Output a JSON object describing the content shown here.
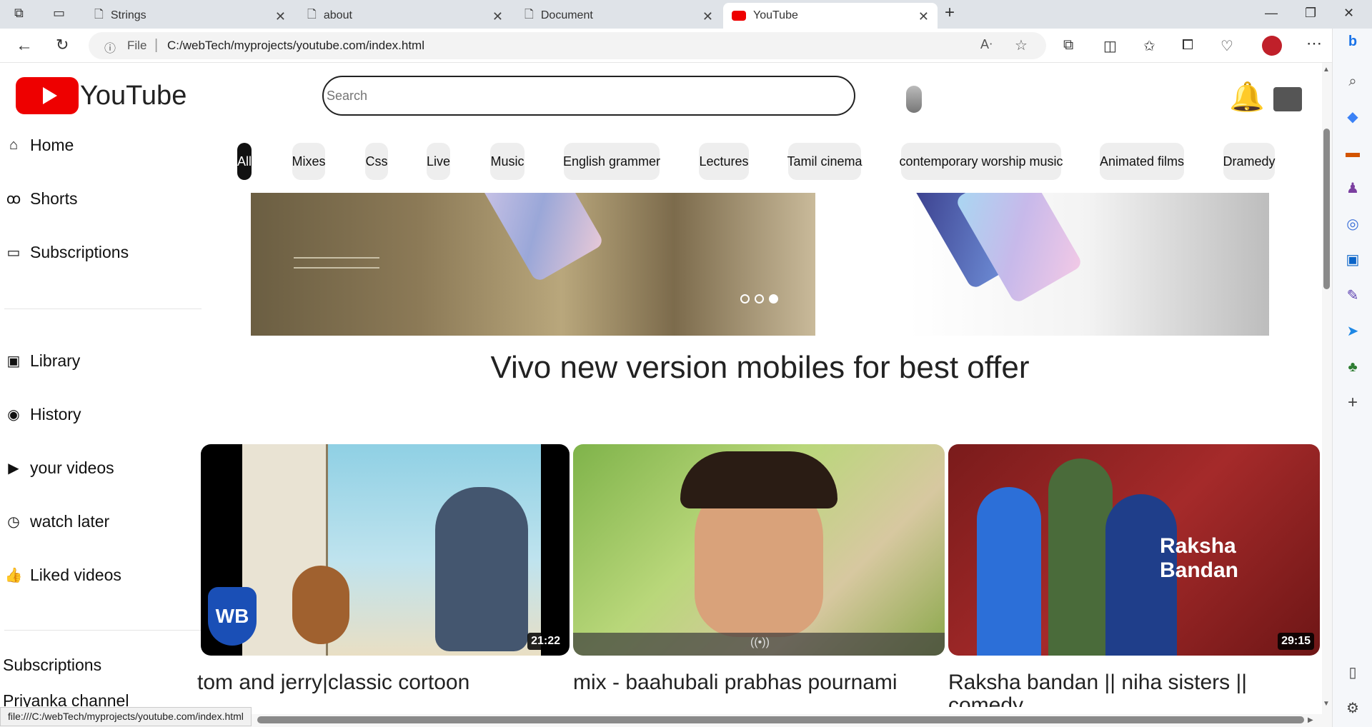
{
  "browser": {
    "tabs": [
      {
        "title": "Strings"
      },
      {
        "title": "about"
      },
      {
        "title": "Document"
      },
      {
        "title": "YouTube"
      }
    ],
    "address": {
      "scheme": "File",
      "url": "C:/webTech/myprojects/youtube.com/index.html"
    },
    "status_url": "file:///C:/webTech/myprojects/youtube.com/index.html"
  },
  "header": {
    "logo_text": "YouTube",
    "search_placeholder": "Search"
  },
  "sidebar": {
    "items": [
      {
        "label": "Home",
        "icon": "home-icon"
      },
      {
        "label": "Shorts",
        "icon": "shorts-icon"
      },
      {
        "label": "Subscriptions",
        "icon": "subscriptions-icon"
      },
      {
        "label": "Library",
        "icon": "library-icon"
      },
      {
        "label": "History",
        "icon": "history-icon"
      },
      {
        "label": "your videos",
        "icon": "your-videos-icon"
      },
      {
        "label": "watch later",
        "icon": "clock-icon"
      },
      {
        "label": "Liked videos",
        "icon": "thumbs-up-icon"
      }
    ],
    "section_title": "Subscriptions",
    "channels": [
      {
        "name": "Priyanka channel"
      }
    ]
  },
  "chips": [
    "All",
    "Mixes",
    "Css",
    "Live",
    "Music",
    "English grammer",
    "Lectures",
    "Tamil cinema",
    "contemporary worship music",
    "Animated films",
    "Dramedy"
  ],
  "banner": {
    "headline": "Vivo new version mobiles for best offer",
    "active_slide": 3,
    "slide_count": 3
  },
  "videos": [
    {
      "title": "tom and jerry|classic cortoon",
      "duration": "21:22"
    },
    {
      "title": "mix - baahubali prabhas pournami",
      "duration": ""
    },
    {
      "title": "Raksha bandan || niha sisters || comedy",
      "duration": "29:15",
      "thumb_text": "Raksha Bandan"
    }
  ],
  "colors": {
    "brand_red": "#ee0000",
    "bell": "#f4b400",
    "chip_bg": "#eeeeee"
  }
}
